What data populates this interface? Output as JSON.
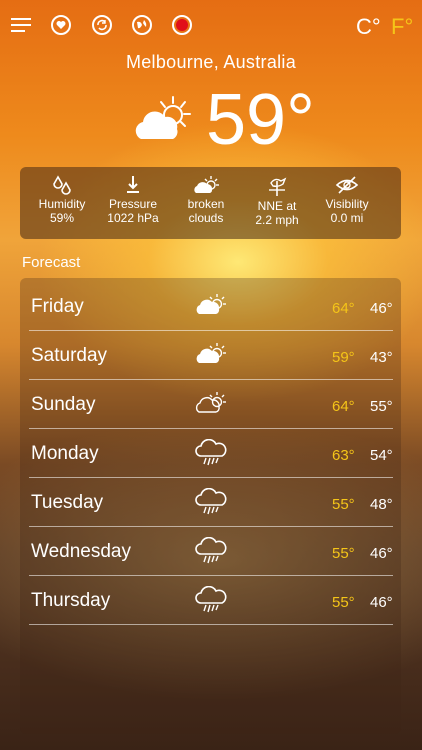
{
  "top_icons": [
    "menu-icon",
    "heart-icon",
    "refresh-icon",
    "globe-icon",
    "record-icon"
  ],
  "units": {
    "celsius": "C°",
    "fahrenheit": "F°",
    "active": "F"
  },
  "location": "Melbourne, Australia",
  "current": {
    "temp": "59°",
    "icon": "partly-cloudy-icon"
  },
  "stats": [
    {
      "icon": "humidity-icon",
      "label": "Humidity",
      "value": "59%"
    },
    {
      "icon": "pressure-icon",
      "label": "Pressure",
      "value": "1022 hPa"
    },
    {
      "icon": "cloud-sun-icon",
      "label": "broken",
      "value": "clouds"
    },
    {
      "icon": "wind-vane-icon",
      "label": "NNE at",
      "value": "2.2 mph"
    },
    {
      "icon": "visibility-off-icon",
      "label": "Visibility",
      "value": "0.0 mi"
    }
  ],
  "forecast_label": "Forecast",
  "forecast": [
    {
      "day": "Friday",
      "icon": "partly-cloudy-icon",
      "hi": "64°",
      "lo": "46°"
    },
    {
      "day": "Saturday",
      "icon": "partly-cloudy-icon",
      "hi": "59°",
      "lo": "43°"
    },
    {
      "day": "Sunday",
      "icon": "partly-cloudy-icon",
      "hi": "64°",
      "lo": "55°"
    },
    {
      "day": "Monday",
      "icon": "rain-icon",
      "hi": "63°",
      "lo": "54°"
    },
    {
      "day": "Tuesday",
      "icon": "rain-icon",
      "hi": "55°",
      "lo": "48°"
    },
    {
      "day": "Wednesday",
      "icon": "rain-icon",
      "hi": "55°",
      "lo": "46°"
    },
    {
      "day": "Thursday",
      "icon": "rain-icon",
      "hi": "55°",
      "lo": "46°"
    }
  ],
  "colors": {
    "accent": "#f5c518",
    "text": "#ffffff"
  }
}
